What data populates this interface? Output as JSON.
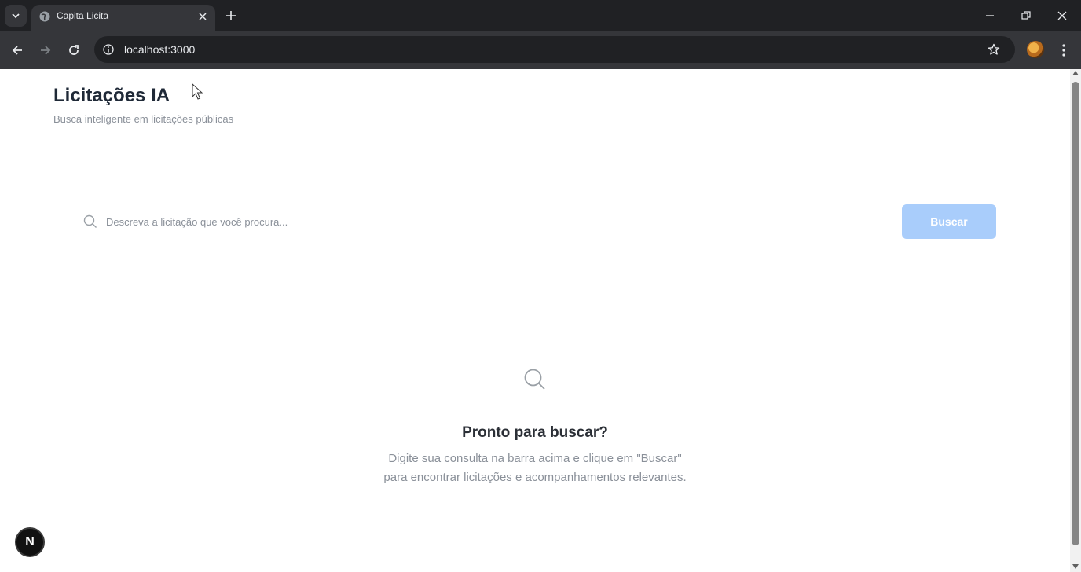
{
  "browser": {
    "tab": {
      "title": "Capita Licita"
    },
    "url": "localhost:3000"
  },
  "header": {
    "title": "Licitações IA",
    "subtitle": "Busca inteligente em licitações públicas"
  },
  "search": {
    "placeholder": "Descreva a licitação que você procura...",
    "value": "",
    "button_label": "Buscar"
  },
  "empty_state": {
    "title": "Pronto para buscar?",
    "line1": "Digite sua consulta na barra acima e clique em \"Buscar\"",
    "line2": "para encontrar licitações e acompanhamentos relevantes."
  },
  "dev_badge": {
    "label": "N"
  },
  "colors": {
    "chrome_dark": "#202124",
    "chrome_toolbar": "#35363a",
    "button_disabled": "#a9cdfb",
    "title_text": "#1f2937",
    "muted_text": "#8a9099"
  },
  "icons": [
    "chevron-down-icon",
    "globe-icon",
    "close-icon",
    "plus-icon",
    "minimize-icon",
    "restore-icon",
    "back-icon",
    "forward-icon",
    "reload-icon",
    "info-icon",
    "star-icon",
    "kebab-menu-icon",
    "search-icon"
  ]
}
